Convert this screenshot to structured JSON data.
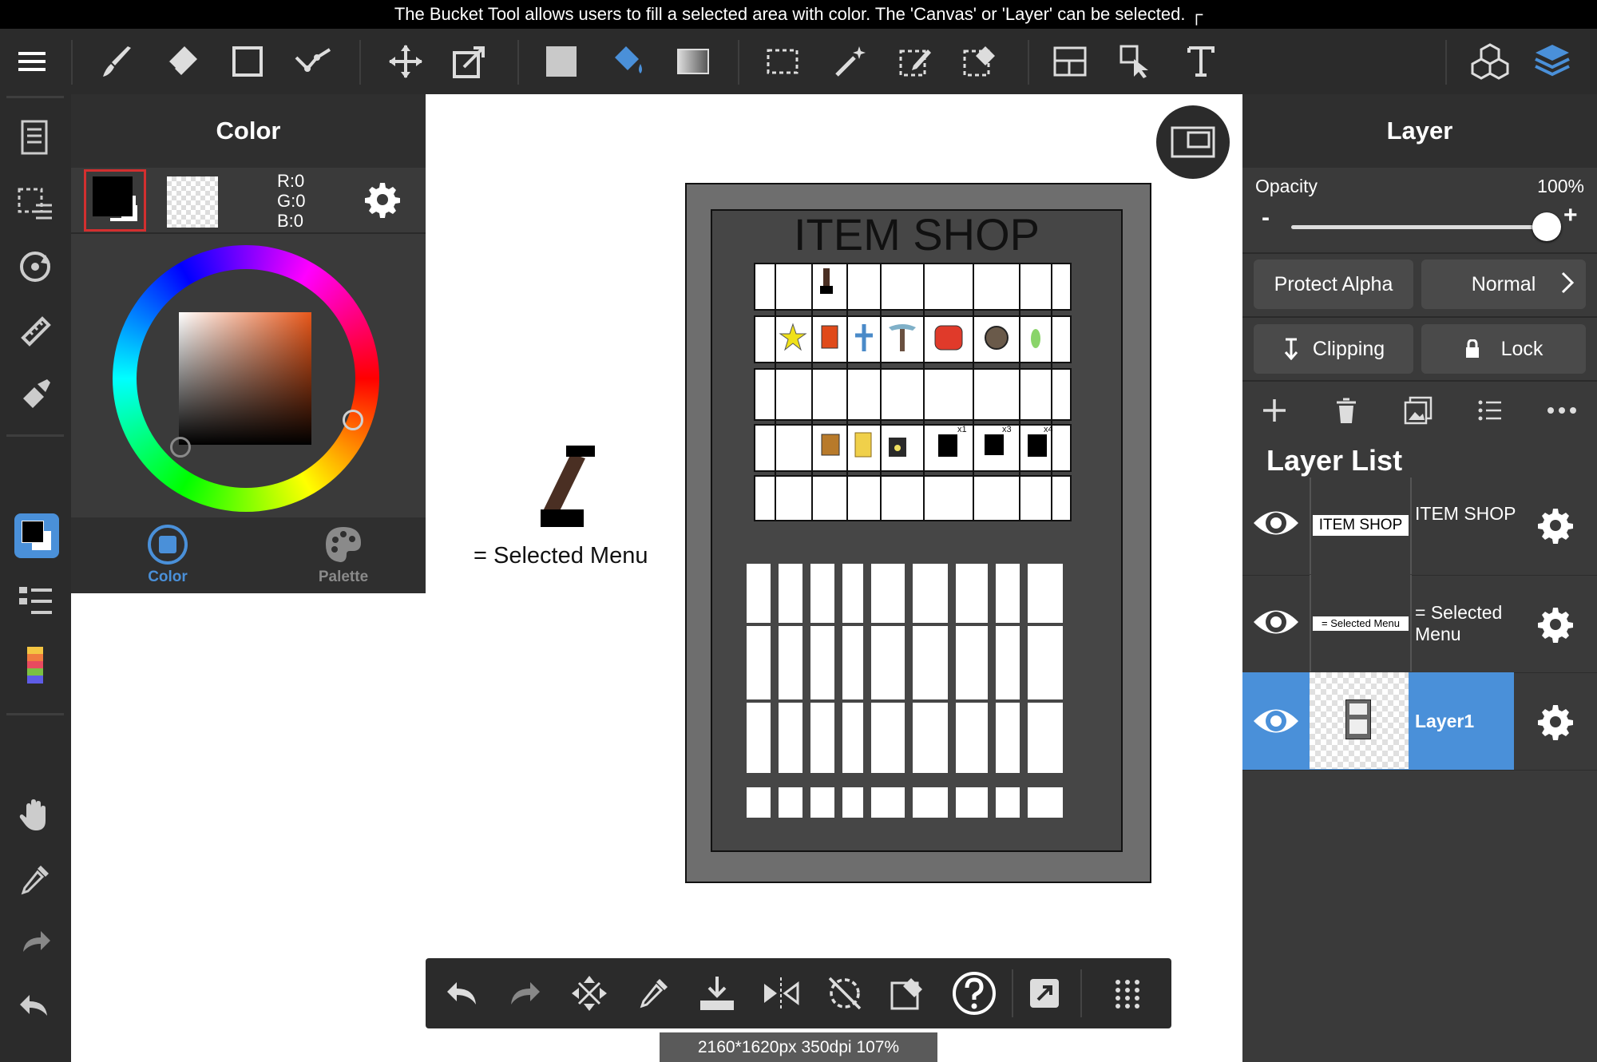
{
  "banner": {
    "text": "The Bucket Tool allows users to fill a selected area with color. The 'Canvas' or 'Layer' can be selected. ┌"
  },
  "color_panel": {
    "title": "Color",
    "rgb": {
      "r": "R:0",
      "g": "G:0",
      "b": "B:0"
    },
    "tabs": [
      {
        "label": "Color",
        "active": true
      },
      {
        "label": "Palette",
        "active": false
      }
    ],
    "colors": {
      "active_tab": "#4a90d9",
      "inactive_tab": "#8a8a8a"
    }
  },
  "canvas": {
    "shop_title": "ITEM SHOP",
    "legend_text": "= Selected Menu",
    "badges": [
      "x1",
      "x3",
      "x4"
    ],
    "frame_button": "frame-icon"
  },
  "layer_panel": {
    "title": "Layer",
    "opacity_label": "Opacity",
    "opacity_value": "100%",
    "opacity_fraction": 1.0,
    "minus": "-",
    "plus": "+",
    "protect_alpha": "Protect Alpha",
    "blend_mode": "Normal",
    "clipping": "Clipping",
    "lock": "Lock",
    "list_title": "Layer List",
    "layers": [
      {
        "name": "ITEM SHOP",
        "thumb_text": "ITEM SHOP",
        "selected": false
      },
      {
        "name": "= Selected Menu",
        "thumb_text": "= Selected Menu",
        "selected": false
      },
      {
        "name": "Layer1",
        "thumb_text": "",
        "selected": true
      }
    ],
    "colors": {
      "selected_row": "#4a90d9",
      "panel": "#3a3a3a"
    }
  },
  "status_bar": {
    "text": "2160*1620px 350dpi 107%"
  }
}
